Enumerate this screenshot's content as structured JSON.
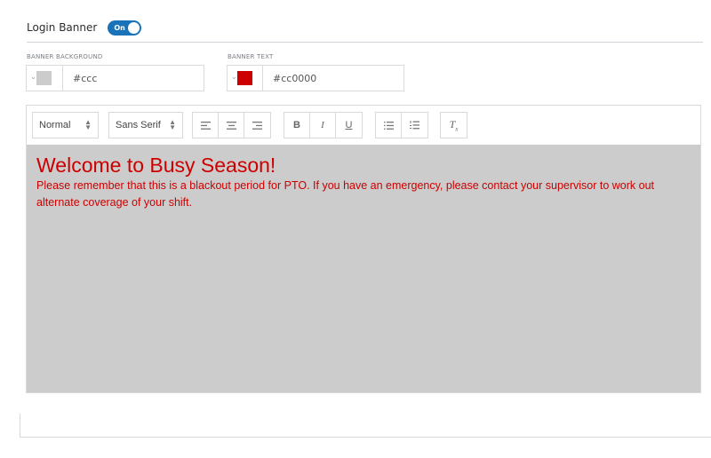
{
  "header": {
    "label": "Login Banner",
    "toggle_label": "On",
    "toggle_on": true
  },
  "banner_background": {
    "label": "BANNER BACKGROUND",
    "value": "#ccc",
    "swatch_color": "#cccccc"
  },
  "banner_text": {
    "label": "BANNER TEXT",
    "value": "#cc0000",
    "swatch_color": "#cc0000"
  },
  "toolbar": {
    "header_select": "Normal",
    "font_select": "Sans Serif",
    "align_buttons": [
      "align-left-icon",
      "align-center-icon",
      "align-right-icon"
    ],
    "bold": "B",
    "italic": "I",
    "underline": "U",
    "list_buttons": [
      "bullet-list-icon",
      "ordered-list-icon"
    ],
    "clear_format": "clear-formatting-icon"
  },
  "editor": {
    "heading": "Welcome to Busy Season!",
    "message": "Please remember that this is a blackout period for PTO. If you have an emergency, please contact your supervisor to work out alternate coverage of your shift.",
    "background_color": "#cccccc",
    "text_color": "#cc0000"
  }
}
